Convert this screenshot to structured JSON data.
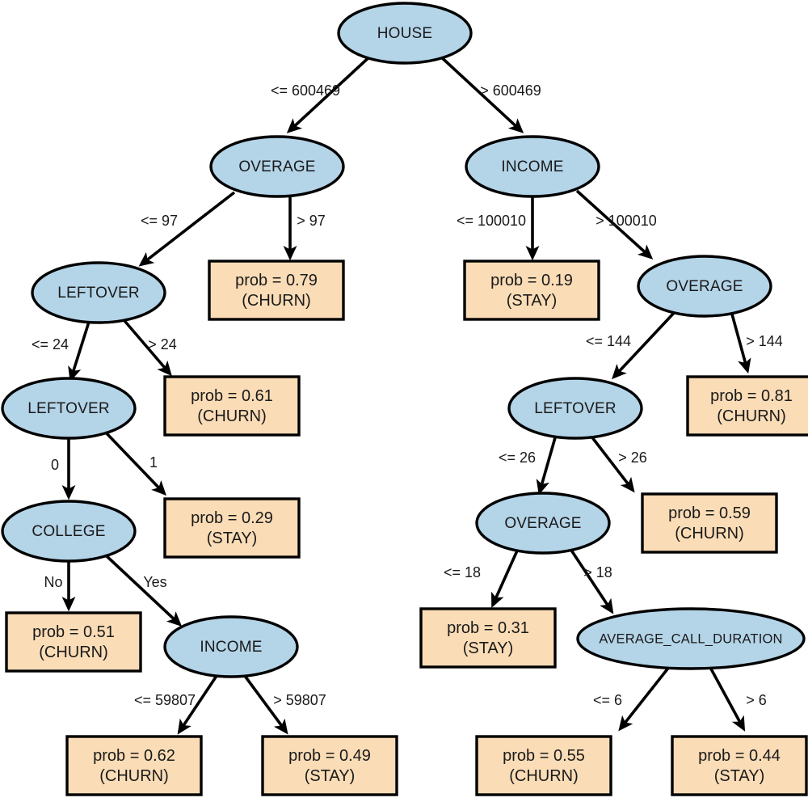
{
  "diagram": {
    "title": "Decision tree for customer churn prediction",
    "type": "decision-tree",
    "colors": {
      "decision_node_fill": "#b4d4e8",
      "leaf_node_fill": "#fadcb6",
      "stroke": "#000000",
      "background": "#ffffff"
    }
  },
  "nodes": {
    "root": {
      "label": "HOUSE",
      "kind": "decision"
    },
    "n_l": {
      "label": "OVERAGE",
      "kind": "decision"
    },
    "n_r": {
      "label": "INCOME",
      "kind": "decision"
    },
    "n_ll": {
      "label": "LEFTOVER",
      "kind": "decision"
    },
    "n_lr_leaf": {
      "label_top": "prob = 0.79",
      "label_bottom": "(CHURN)",
      "kind": "leaf"
    },
    "n_lll": {
      "label": "LEFTOVER",
      "kind": "decision"
    },
    "n_llr_leaf": {
      "label_top": "prob = 0.61",
      "label_bottom": "(CHURN)",
      "kind": "leaf"
    },
    "n_llll": {
      "label": "COLLEGE",
      "kind": "decision"
    },
    "n_lllr_leaf": {
      "label_top": "prob = 0.29",
      "label_bottom": "(STAY)",
      "kind": "leaf"
    },
    "n_lllll_leaf": {
      "label_top": "prob = 0.51",
      "label_bottom": "(CHURN)",
      "kind": "leaf"
    },
    "n_llllr": {
      "label": "INCOME",
      "kind": "decision"
    },
    "n_llllrl_leaf": {
      "label_top": "prob = 0.62",
      "label_bottom": "(CHURN)",
      "kind": "leaf"
    },
    "n_llllrr_leaf": {
      "label_top": "prob = 0.49",
      "label_bottom": "(STAY)",
      "kind": "leaf"
    },
    "n_rl_leaf": {
      "label_top": "prob = 0.19",
      "label_bottom": "(STAY)",
      "kind": "leaf"
    },
    "n_rr": {
      "label": "OVERAGE",
      "kind": "decision"
    },
    "n_rrl": {
      "label": "LEFTOVER",
      "kind": "decision"
    },
    "n_rrr_leaf": {
      "label_top": "prob = 0.81",
      "label_bottom": "(CHURN)",
      "kind": "leaf"
    },
    "n_rrll": {
      "label": "OVERAGE",
      "kind": "decision"
    },
    "n_rrlr_leaf": {
      "label_top": "prob = 0.59",
      "label_bottom": "(CHURN)",
      "kind": "leaf"
    },
    "n_rrlll_leaf": {
      "label_top": "prob = 0.31",
      "label_bottom": "(STAY)",
      "kind": "leaf"
    },
    "n_rrllr": {
      "label": "AVERAGE_CALL_DURATION",
      "kind": "decision"
    },
    "n_rrllrl_leaf": {
      "label_top": "prob = 0.55",
      "label_bottom": "(CHURN)",
      "kind": "leaf"
    },
    "n_rrllrr_leaf": {
      "label_top": "prob = 0.44",
      "label_bottom": "(STAY)",
      "kind": "leaf"
    }
  },
  "edges": {
    "root_left": "<= 600469",
    "root_right": "> 600469",
    "l_left": "<= 97",
    "l_right": "> 97",
    "ll_left": "<= 24",
    "ll_right": "> 24",
    "lll_left": "0",
    "lll_right": "1",
    "llll_left": "No",
    "llll_right": "Yes",
    "llllr_left": "<= 59807",
    "llllr_right": "> 59807",
    "r_left": "<= 100010",
    "r_right": "> 100010",
    "rr_left": "<= 144",
    "rr_right": "> 144",
    "rrl_left": "<= 26",
    "rrl_right": "> 26",
    "rrll_left": "<= 18",
    "rrll_right": "> 18",
    "rrllr_left": "<= 6",
    "rrllr_right": "> 6"
  }
}
